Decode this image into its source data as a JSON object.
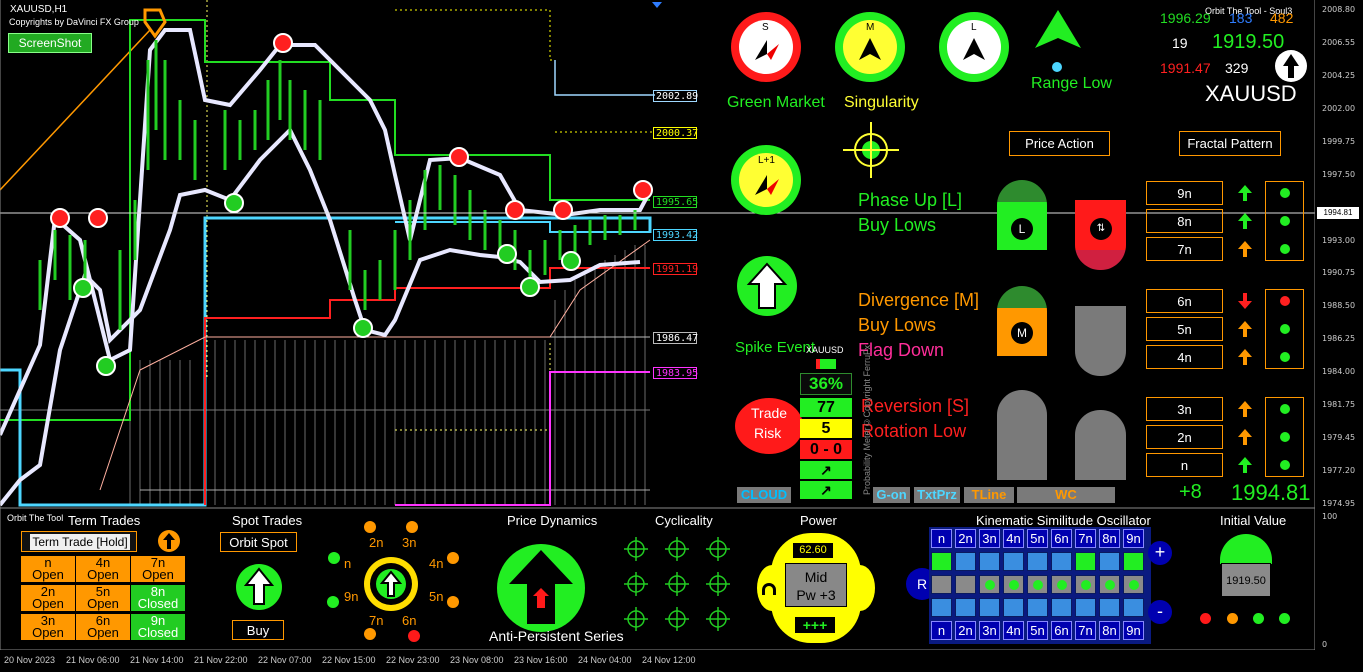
{
  "chart": {
    "symbol_tf": "XAUUSD,H1",
    "copyright": "Copyrights by DaVinci FX Group",
    "screenshot_label": "ScreenShot"
  },
  "levels": [
    "2002.89",
    "2000.37",
    "1995.65",
    "1993.42",
    "1991.19",
    "1986.47",
    "1983.95"
  ],
  "yaxis": {
    "0": "2008.80",
    "1": "2006.55",
    "2": "2004.25",
    "3": "2002.00",
    "4": "1999.75",
    "5": "1997.50",
    "6": "1993.00",
    "7": "1990.75",
    "8": "1988.50",
    "9": "1986.25",
    "10": "1984.00",
    "11": "1981.75",
    "12": "1979.45",
    "13": "1977.20",
    "14": "1974.95",
    "15": "100",
    "16": "0",
    "current": "1994.81"
  },
  "xaxis": [
    "20 Nov 2023",
    "21 Nov 06:00",
    "21 Nov 14:00",
    "21 Nov 22:00",
    "22 Nov 07:00",
    "22 Nov 15:00",
    "22 Nov 23:00",
    "23 Nov 08:00",
    "23 Nov 16:00",
    "24 Nov 04:00",
    "24 Nov 12:00"
  ],
  "gauges": {
    "s": "S",
    "m": "M",
    "l": "L",
    "l1": "L+1"
  },
  "dash": {
    "range_low": "Range Low",
    "green_market": "Green Market",
    "singularity": "Singularity",
    "price_action": "Price Action",
    "fractal_pattern": "Fractal Pattern",
    "spike_event": "Spike Event",
    "trade": "Trade",
    "risk": "Risk"
  },
  "stats": {
    "tool": "Orbit The Tool - Soul3",
    "high": "1996.29",
    "mid": "183",
    "right": "482",
    "count": "19",
    "price": "1919.50",
    "low": "1991.47",
    "pts": "329",
    "symbol": "XAUUSD",
    "delta": "+8",
    "bottom_price": "1994.81"
  },
  "phases": [
    {
      "title": "Phase Up [L]",
      "sub": "Buy Lows"
    },
    {
      "title": "Divergence [M]",
      "sub": "Buy Lows",
      "extra": "Flag Down"
    },
    {
      "title": "Reversion [S]",
      "sub": "Rotation Low"
    }
  ],
  "pills": {
    "l": "L",
    "m": "M"
  },
  "nrows": [
    {
      "label": "9n"
    },
    {
      "label": "8n"
    },
    {
      "label": "7n"
    },
    {
      "label": "6n"
    },
    {
      "label": "5n"
    },
    {
      "label": "4n"
    },
    {
      "label": "3n"
    },
    {
      "label": "2n"
    },
    {
      "label": "n"
    }
  ],
  "meter": {
    "symbol": "XAUUSD",
    "pct": "36%",
    "v1": "77",
    "v2": "5",
    "v3": "0 - 0",
    "caption": "Probability Meter©Copyright FerruFx"
  },
  "buttons": {
    "cloud": "CLOUD",
    "gon": "G-on",
    "txtprz": "TxtPrz",
    "tline": "TLine",
    "wc": "WC"
  },
  "bottom": {
    "panel_title": "Orbit The Tool",
    "term_trades": "Term Trades",
    "term_hold": "Term Trade [Hold]",
    "spot_trades": "Spot Trades",
    "orbit_spot": "Orbit Spot",
    "buy": "Buy",
    "price_dynamics": "Price Dynamics",
    "anti_persistent": "Anti-Persistent Series",
    "cyclicality": "Cyclicality",
    "power": "Power",
    "kso": "Kinematic Similitude Oscillator",
    "initial_value": "Initial Value",
    "initial_value_num": "1919.50"
  },
  "terms": [
    {
      "n": "n",
      "s": "Open"
    },
    {
      "n": "4n",
      "s": "Open"
    },
    {
      "n": "7n",
      "s": "Open"
    },
    {
      "n": "2n",
      "s": "Open"
    },
    {
      "n": "5n",
      "s": "Open"
    },
    {
      "n": "8n",
      "s": "Closed"
    },
    {
      "n": "3n",
      "s": "Open"
    },
    {
      "n": "6n",
      "s": "Open"
    },
    {
      "n": "9n",
      "s": "Closed"
    }
  ],
  "orbit": {
    "n2": "2n",
    "n3": "3n",
    "n": "n",
    "n4": "4n",
    "n9": "9n",
    "n5": "5n",
    "n7": "7n",
    "n6": "6n"
  },
  "power": {
    "value": "62.60",
    "mid": "Mid",
    "pw": "Pw +3",
    "plus": "+++"
  },
  "kso": {
    "r": "R",
    "plus": "+",
    "minus": "-",
    "labels": [
      "n",
      "2n",
      "3n",
      "4n",
      "5n",
      "6n",
      "7n",
      "8n",
      "9n"
    ],
    "row1_green": [
      true,
      false,
      false,
      false,
      false,
      false,
      true,
      false,
      true
    ],
    "row2_dots": [
      false,
      false,
      true,
      true,
      true,
      true,
      true,
      true,
      true
    ]
  }
}
